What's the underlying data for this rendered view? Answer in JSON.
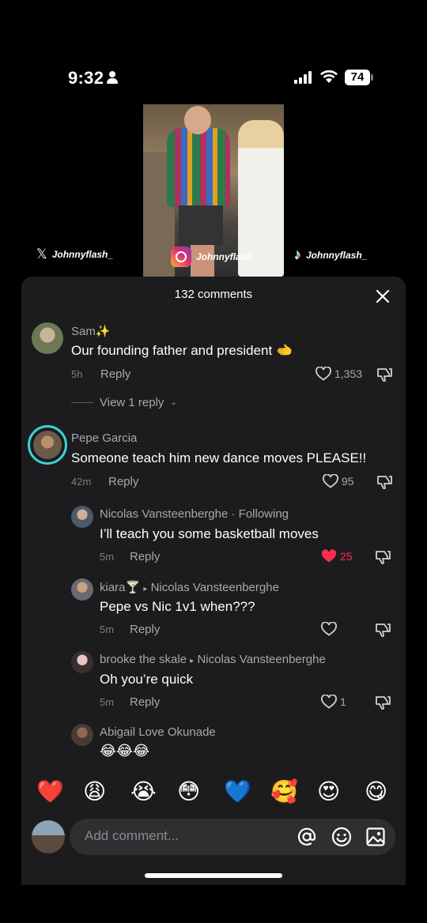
{
  "status_bar": {
    "time": "9:32",
    "battery": "74"
  },
  "video": {
    "handle_x": "Johnnyflash_",
    "handle_instagram": "Johnnyflash_",
    "handle_tiktok": "Johnnyflash_"
  },
  "panel": {
    "title": "132 comments"
  },
  "comments": [
    {
      "user": "Sam✨",
      "text": "Our founding father and president 🫲",
      "age": "5h",
      "reply": "Reply",
      "likes": "1,353",
      "liked": false,
      "view_replies": "View 1 reply"
    },
    {
      "user": "Pepe Garcia",
      "text": "Someone teach him new dance moves PLEASE!!",
      "age": "42m",
      "reply": "Reply",
      "likes": "95",
      "liked": false
    },
    {
      "user": "Nicolas Vansteenberghe",
      "following": "· Following",
      "text": "I’ll teach you some basketball moves",
      "age": "5m",
      "reply": "Reply",
      "likes": "25",
      "liked": true
    },
    {
      "user": "kiara🍸",
      "reply_to": "Nicolas Vansteenberghe",
      "text": "Pepe vs Nic 1v1 when???",
      "age": "5m",
      "reply": "Reply",
      "likes": "",
      "liked": false
    },
    {
      "user": "brooke the skale",
      "reply_to": "Nicolas Vansteenberghe",
      "text": "Oh you’re quick",
      "age": "5m",
      "reply": "Reply",
      "likes": "1",
      "liked": false
    },
    {
      "user": "Abigail Love Okunade",
      "text": "😂😂😂"
    }
  ],
  "emojis": [
    "❤️",
    "😩",
    "😭",
    "😳",
    "💙",
    "🥰",
    "😍",
    "😋"
  ],
  "composer": {
    "placeholder": "Add comment..."
  },
  "colors": {
    "panel": "#1c1c1e",
    "like_active": "#fe2c55",
    "accent_ring": "#3ad1d1"
  }
}
